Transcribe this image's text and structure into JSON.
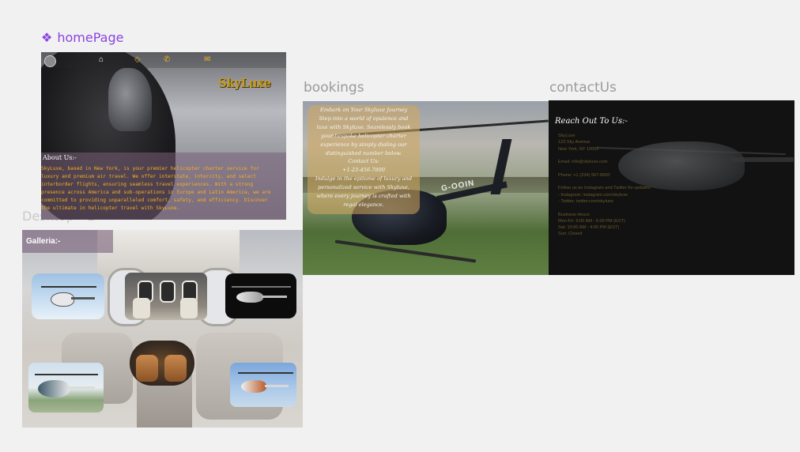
{
  "canvas": {
    "frames": {
      "home": "homePage",
      "bookings": "bookings",
      "contact": "contactUs",
      "desktop": "Desktop - 1"
    },
    "component_icon": "component-diamond-icon",
    "accent_color": "#8b43e0"
  },
  "home": {
    "nav": {
      "home_icon": "home-icon",
      "bookings_icon": "diamond-icon",
      "phone_icon": "phone-icon",
      "mail_icon": "mail-icon"
    },
    "brand": "SkyLuxe",
    "about_title": "About Us:-",
    "about_text": "SkyLuxe, based in New York, is your premier helicopter charter service for luxury and premium air travel. We offer interstate, intercity, and select interborder flights, ensuring seamless travel experiences. With a strong presence across America and sub-operations in Europe and Latin America, we are committed to providing unparalleled comfort, safety, and efficiency. Discover the ultimate in helicopter travel with SkyLuxe.",
    "accent_color": "#f3b11c"
  },
  "galleria": {
    "title": "Galleria:-"
  },
  "bookings": {
    "text": "Embark on Your Skyluxe Journey\nStep into a world of opulence and\nluxe with Skyluxe. Seamlessly book\nyour bespoke helicopter charter\nexperience by simply dialing our\ndistinguished number below.\nContact Us:\n+1-23-456-7890\nIndulge in the epitome of luxury and\npersonalized service with Skyluxe,\nwhere every journey is crafted with\nregal elegance.",
    "registration": "G-OOIN"
  },
  "contact": {
    "heading": "Reach Out To Us:-",
    "info": "SkyLuxe\n123 Sky Avenue\nNew York, NY 10001\n\nEmail: info@skyluxe.com\n\nPhone: +1 (234) 567-8900\n\nFollow us on Instagram and Twitter for updates:\n- Instagram: instagram.com/skyluxe\n- Twitter: twitter.com/skyluxe\n\nBusiness Hours:\nMon-Fri: 9:00 AM - 6:00 PM (EST)\nSat: 10:00 AM - 4:00 PM (EST)\nSun: Closed"
  }
}
